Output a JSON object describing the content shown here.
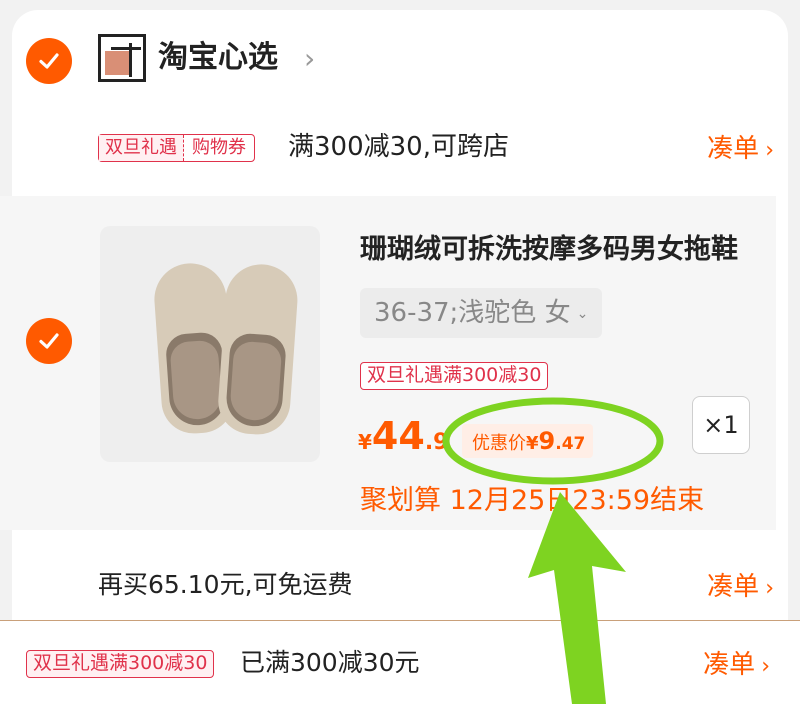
{
  "shop": {
    "name": "淘宝心选",
    "chevron": "›"
  },
  "coupon": {
    "tag_left": "双旦礼遇",
    "tag_right": "购物券",
    "text": "满300减30,可跨店",
    "link": "凑单",
    "link_chevron": "›"
  },
  "item": {
    "title": "珊瑚绒可拆洗按摩多码男女拖鞋",
    "sku": "36-37;浅驼色 女",
    "sku_dropdown": "⌄",
    "activity_tag": "双旦礼遇满300减30",
    "price": {
      "yen": "¥",
      "int": "44",
      "dec": ".9"
    },
    "discount": {
      "label": "优惠价",
      "yen": "¥",
      "int": "9",
      "dec": ".47"
    },
    "quantity": "×1",
    "deal": "聚划算 12月25日23:59结束"
  },
  "shipping": {
    "text": "再买65.10元,可免运费",
    "link": "凑单",
    "link_chevron": "›"
  },
  "bottom": {
    "tag": "双旦礼遇满300减30",
    "text": "已满300减30元",
    "link": "凑单",
    "link_chevron": "›"
  },
  "colors": {
    "accent": "#ff5a00",
    "promo_red": "#e0324b",
    "annotation_green": "#7ed321"
  },
  "icons": {
    "checkbox": "check-icon",
    "logo": "shop-logo-icon",
    "arrow": "annotation-arrow"
  }
}
